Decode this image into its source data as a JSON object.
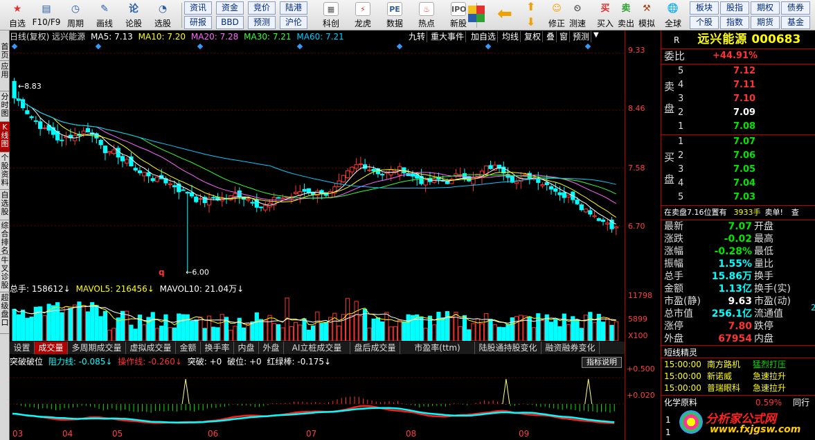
{
  "toolbar": {
    "buttons": [
      {
        "label": "自选",
        "icon": "star-icon"
      },
      {
        "label": "F10/F9",
        "icon": "f10-icon"
      },
      {
        "label": "周期",
        "icon": "clock-icon"
      },
      {
        "label": "画线",
        "icon": "pen-icon"
      },
      {
        "label": "论股",
        "icon": "discuss-icon"
      },
      {
        "label": "选股",
        "icon": "select-icon"
      }
    ],
    "small_row1": [
      "资讯",
      "资金",
      "竞价",
      "陆港"
    ],
    "small_row2": [
      "研报",
      "BBD",
      "预测",
      "沪伦"
    ],
    "buttons2": [
      {
        "label": "科创",
        "icon": "kechuang-icon"
      },
      {
        "label": "龙虎",
        "icon": "dragon-icon"
      },
      {
        "label": "数据",
        "icon": "pe-icon"
      },
      {
        "label": "热点",
        "icon": "hot-icon"
      },
      {
        "label": "新股",
        "icon": "ipo-icon"
      }
    ],
    "buttons3": [
      {
        "label": "修正",
        "icon": "fix-icon"
      },
      {
        "label": "测速",
        "icon": "speed-icon"
      },
      {
        "label": "买入",
        "icon": "buy-icon"
      },
      {
        "label": "卖出",
        "icon": "sell-icon"
      },
      {
        "label": "模拟",
        "icon": "hammer-icon"
      },
      {
        "label": "全球",
        "icon": "globe-icon"
      }
    ],
    "buy_glyph": "买",
    "sell_glyph": "卖",
    "right_row1": [
      "板块",
      "股指",
      "期权",
      "债券"
    ],
    "right_row2": [
      "个股",
      "指数",
      "期货",
      "基金"
    ]
  },
  "left_tabs": [
    "首页",
    "应用",
    "分时图",
    "K线图",
    "个股资料",
    "自选股",
    "综合排名",
    "牛叉诊股",
    "超级盘口"
  ],
  "kline": {
    "title": "日线(复权) 远兴能源",
    "ma5": "MA5: 7.13",
    "ma10": "MA10: 7.20",
    "ma20": "MA20: 7.28",
    "ma30": "MA30: 7.21",
    "ma60": "MA60: 7.21",
    "tools": [
      "九转",
      "重大事件",
      "加自选",
      "均线",
      "复权",
      "叠",
      "窗",
      "预测"
    ],
    "price_axis": [
      "9.33",
      "8.46",
      "7.58",
      "6.70"
    ],
    "high_label": "8.83",
    "low_label": "6.00",
    "q_mark": "q"
  },
  "volume": {
    "header_total": "总手: 158612↓",
    "header_mavol5": "MAVOL5: 216456↓",
    "header_mavol10": "MAVOL10: 21.04万↓",
    "axis": [
      "11798",
      "5899",
      "X100"
    ]
  },
  "bottom_tabs": [
    "设置",
    "成交量",
    "多周期成交量",
    "虚拟成交量",
    "金额",
    "换手率",
    "内盘",
    "外盘",
    "AI立桩成交量",
    "盘后成交量",
    "市盈率(ttm)",
    "陆股通持股变化",
    "融资融券变化"
  ],
  "indicator": {
    "name": "突破破位",
    "resist": "阻力线: -0.085↓",
    "operate": "操作线: -0.260↓",
    "break": "突破: +0",
    "breakdown": "破位: +0",
    "redline": "红绿棒: -0.175↓",
    "help_btn": "指标说明",
    "axis": [
      "+0.500",
      "+0.020"
    ]
  },
  "x_axis": [
    "03",
    "04",
    "05",
    "06",
    "07",
    "08",
    "09"
  ],
  "stock": {
    "code_prefix": "R",
    "name": "远兴能源",
    "code": "000683",
    "webi_label": "委比",
    "webi": "+44.91%",
    "sell_label": [
      "卖",
      "盘"
    ],
    "buy_label": [
      "买",
      "盘"
    ],
    "sell": [
      {
        "n": "5",
        "p": "7.12"
      },
      {
        "n": "4",
        "p": "7.11"
      },
      {
        "n": "3",
        "p": "7.10"
      },
      {
        "n": "2",
        "p": "7.09"
      },
      {
        "n": "1",
        "p": "7.08"
      }
    ],
    "buy": [
      {
        "n": "1",
        "p": "7.07"
      },
      {
        "n": "2",
        "p": "7.06"
      },
      {
        "n": "3",
        "p": "7.05"
      },
      {
        "n": "4",
        "p": "7.04"
      },
      {
        "n": "5",
        "p": "7.03"
      }
    ],
    "notice_a": "在卖盘7.16位置有",
    "notice_b": "3933手",
    "notice_c": "卖单!",
    "notice_d": "查",
    "quote_left": [
      {
        "k": "最新",
        "v": "7.07",
        "c": "green"
      },
      {
        "k": "涨跌",
        "v": "-0.02",
        "c": "green"
      },
      {
        "k": "涨幅",
        "v": "-0.28%",
        "c": "green"
      },
      {
        "k": "振幅",
        "v": "1.55%",
        "c": "cyan"
      },
      {
        "k": "总手",
        "v": "15.86万",
        "c": "cyan"
      },
      {
        "k": "金额",
        "v": "1.13亿",
        "c": "cyan"
      },
      {
        "k": "市盈(静)",
        "v": "9.63",
        "c": "white"
      },
      {
        "k": "总市值",
        "v": "256.1亿",
        "c": "cyan"
      },
      {
        "k": "涨停",
        "v": "7.80",
        "c": "red"
      },
      {
        "k": "外盘",
        "v": "67954",
        "c": "red"
      }
    ],
    "quote_right": [
      "开盘",
      "最高",
      "最低",
      "量比",
      "换手",
      "换手(实)",
      "市盈(动)",
      "流通值",
      "跌停",
      "内盘"
    ],
    "quote_right_extra": "2",
    "sprite_title": "短线精灵",
    "sprites": [
      {
        "time": "15:00:00",
        "name": "南方路机",
        "sig": "猛烈打压"
      },
      {
        "time": "15:00:00",
        "name": "新诺威",
        "sig": "急速拉升"
      },
      {
        "time": "15:00:00",
        "name": "普瑞眼科",
        "sig": "急速拉升"
      }
    ],
    "chem_label": "化学原料",
    "chem_pct": "0.59%",
    "chem_extra": "同行",
    "chem_nums": [
      "1",
      "1"
    ],
    "logo_text": "分析家公式网",
    "logo_url": "www.fxjgsw.com"
  }
}
